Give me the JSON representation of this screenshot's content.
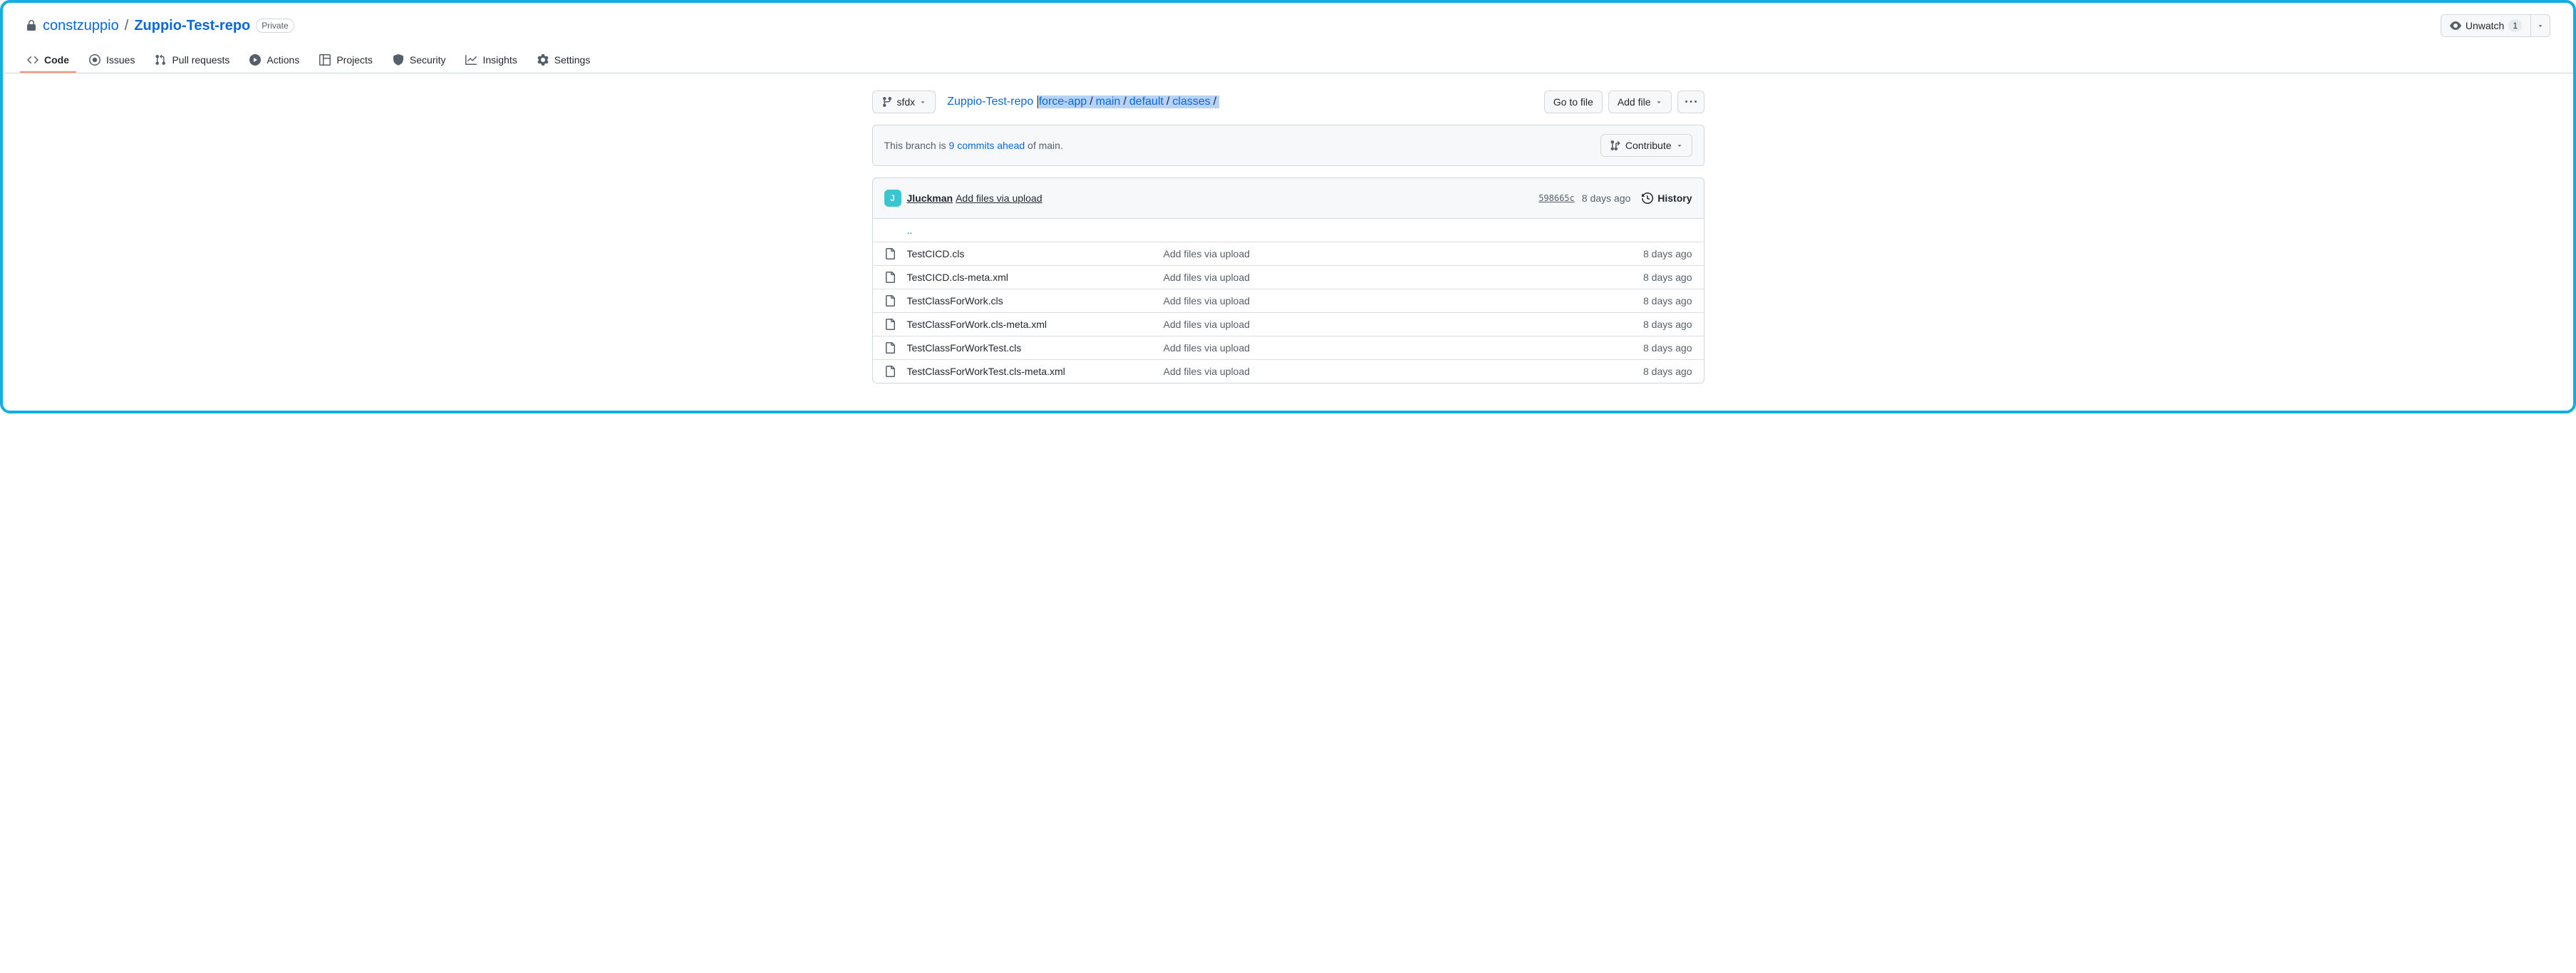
{
  "repo": {
    "owner": "constzuppio",
    "name": "Zuppio-Test-repo",
    "visibility": "Private"
  },
  "watch": {
    "label": "Unwatch",
    "count": "1"
  },
  "tabs": [
    {
      "label": "Code",
      "icon": "code"
    },
    {
      "label": "Issues",
      "icon": "issues"
    },
    {
      "label": "Pull requests",
      "icon": "pr"
    },
    {
      "label": "Actions",
      "icon": "actions"
    },
    {
      "label": "Projects",
      "icon": "projects"
    },
    {
      "label": "Security",
      "icon": "security"
    },
    {
      "label": "Insights",
      "icon": "insights"
    },
    {
      "label": "Settings",
      "icon": "settings"
    }
  ],
  "branch": "sfdx",
  "breadcrumb": {
    "root": "Zuppio-Test-repo",
    "parts": [
      "force-app",
      "main",
      "default",
      "classes"
    ]
  },
  "buttons": {
    "go_to_file": "Go to file",
    "add_file": "Add file"
  },
  "compare": {
    "prefix": "This branch is ",
    "link": "9 commits ahead",
    "suffix": " of main.",
    "contribute": "Contribute"
  },
  "latest_commit": {
    "author": "Jluckman",
    "message": "Add files via upload",
    "sha": "598665c",
    "time": "8 days ago",
    "history": "History"
  },
  "updir": "..",
  "files": [
    {
      "name": "TestCICD.cls",
      "msg": "Add files via upload",
      "time": "8 days ago"
    },
    {
      "name": "TestCICD.cls-meta.xml",
      "msg": "Add files via upload",
      "time": "8 days ago"
    },
    {
      "name": "TestClassForWork.cls",
      "msg": "Add files via upload",
      "time": "8 days ago"
    },
    {
      "name": "TestClassForWork.cls-meta.xml",
      "msg": "Add files via upload",
      "time": "8 days ago"
    },
    {
      "name": "TestClassForWorkTest.cls",
      "msg": "Add files via upload",
      "time": "8 days ago"
    },
    {
      "name": "TestClassForWorkTest.cls-meta.xml",
      "msg": "Add files via upload",
      "time": "8 days ago"
    }
  ]
}
